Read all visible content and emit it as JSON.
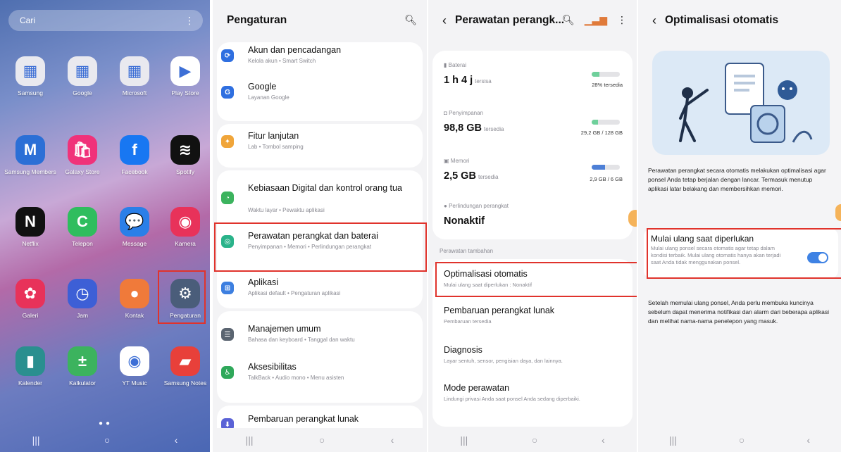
{
  "home": {
    "search_placeholder": "Cari",
    "apps": [
      {
        "label": "Samsung",
        "color": "#e9e9ef",
        "glyph": "▦"
      },
      {
        "label": "Google",
        "color": "#e9e9ef",
        "glyph": "▦"
      },
      {
        "label": "Microsoft",
        "color": "#e9e9ef",
        "glyph": "▦"
      },
      {
        "label": "Play Store",
        "color": "#ffffff",
        "glyph": "▶"
      },
      {
        "label": "Samsung Members",
        "color": "#2b6fd6",
        "glyph": "M"
      },
      {
        "label": "Galaxy Store",
        "color": "#f0327a",
        "glyph": "🛍"
      },
      {
        "label": "Facebook",
        "color": "#1877f2",
        "glyph": "f"
      },
      {
        "label": "Spotify",
        "color": "#111111",
        "glyph": "≋"
      },
      {
        "label": "Netflix",
        "color": "#111111",
        "glyph": "N"
      },
      {
        "label": "Telepon",
        "color": "#2fbd5e",
        "glyph": "C"
      },
      {
        "label": "Message",
        "color": "#2a7fe8",
        "glyph": "💬"
      },
      {
        "label": "Kamera",
        "color": "#e8325a",
        "glyph": "◉"
      },
      {
        "label": "Galeri",
        "color": "#e8325a",
        "glyph": "✿"
      },
      {
        "label": "Jam",
        "color": "#3d5fd6",
        "glyph": "◷"
      },
      {
        "label": "Kontak",
        "color": "#f07a3a",
        "glyph": "●"
      },
      {
        "label": "Pengaturan",
        "color": "#4a5d7a",
        "glyph": "⚙"
      },
      {
        "label": "Kalender",
        "color": "#2a8f8f",
        "glyph": "▮"
      },
      {
        "label": "Kalkulator",
        "color": "#3cb35e",
        "glyph": "±"
      },
      {
        "label": "YT Music",
        "color": "#ffffff",
        "glyph": "◉"
      },
      {
        "label": "Samsung Notes",
        "color": "#e8403a",
        "glyph": "▰"
      }
    ]
  },
  "settings": {
    "title": "Pengaturan",
    "items": [
      {
        "title": "Akun dan pencadangan",
        "sub": "Kelola akun • Smart Switch",
        "color": "#2f6fe0",
        "glyph": "⟳"
      },
      {
        "title": "Google",
        "sub": "Layanan Google",
        "color": "#2f6fe0",
        "glyph": "G"
      },
      {
        "title": "Fitur lanjutan",
        "sub": "Lab • Tombol samping",
        "color": "#f0a53a",
        "glyph": "✦"
      },
      {
        "title": "Kebiasaan Digital dan kontrol orang tua",
        "sub": "Waktu layar • Pewaktu aplikasi",
        "color": "#3cb35e",
        "glyph": "◔"
      },
      {
        "title": "Perawatan perangkat dan baterai",
        "sub": "Penyimpanan • Memori • Perlindungan perangkat",
        "color": "#2ab38a",
        "glyph": "◎"
      },
      {
        "title": "Aplikasi",
        "sub": "Aplikasi default • Pengaturan aplikasi",
        "color": "#3d7fe0",
        "glyph": "⊞"
      },
      {
        "title": "Manajemen umum",
        "sub": "Bahasa dan keyboard • Tanggal dan waktu",
        "color": "#5a6470",
        "glyph": "☰"
      },
      {
        "title": "Aksesibilitas",
        "sub": "TalkBack • Audio mono • Menu asisten",
        "color": "#2fa85a",
        "glyph": "♿"
      },
      {
        "title": "Pembaruan perangkat lunak",
        "sub": "",
        "color": "#5a62d6",
        "glyph": "⬇"
      }
    ]
  },
  "care": {
    "title": "Perawatan perangk...",
    "battery": {
      "label": "Baterai",
      "value": "1 h 4 j",
      "unit": "tersisa",
      "note": "28% tersedia",
      "level": 28
    },
    "storage": {
      "label": "Penyimpanan",
      "value": "98,8 GB",
      "unit": "tersedia",
      "note": "29,2 GB / 128 GB",
      "level": 23
    },
    "memory": {
      "label": "Memori",
      "value": "2,5 GB",
      "unit": "tersedia",
      "note": "2,9 GB / 6 GB",
      "level": 48
    },
    "protection": {
      "label": "Perlindungan perangkat",
      "value": "Nonaktif"
    },
    "extra_label": "Perawatan tambahan",
    "auto_opt": {
      "title": "Optimalisasi otomatis",
      "sub": "Mulai ulang saat diperlukan : Nonaktif"
    },
    "software_update": {
      "title": "Pembaruan perangkat lunak",
      "sub": "Pembaruan tersedia"
    },
    "diagnosis": {
      "title": "Diagnosis",
      "sub": "Layar sentuh, sensor, pengisian daya, dan lainnya."
    },
    "maintenance": {
      "title": "Mode perawatan",
      "sub": "Lindungi privasi Anda saat ponsel Anda sedang diperbaiki."
    }
  },
  "opt": {
    "title": "Optimalisasi otomatis",
    "desc": "Perawatan perangkat secara otomatis melakukan optimalisasi agar ponsel Anda tetap berjalan dengan lancar. Termasuk menutup aplikasi latar belakang dan membersihkan memori.",
    "restart_title": "Mulai ulang saat diperlukan",
    "restart_sub": "Mulai ulang ponsel secara otomatis agar tetap dalam kondisi terbaik. Mulai ulang otomatis hanya akan terjadi saat Anda tidak menggunakan ponsel.",
    "note": "Setelah memulai ulang ponsel, Anda perlu membuka kuncinya sebelum dapat menerima notifikasi dan alarm dari beberapa aplikasi dan melihat nama-nama penelepon yang masuk."
  },
  "nav": {
    "recent": "|||",
    "home": "○",
    "back": "‹"
  }
}
